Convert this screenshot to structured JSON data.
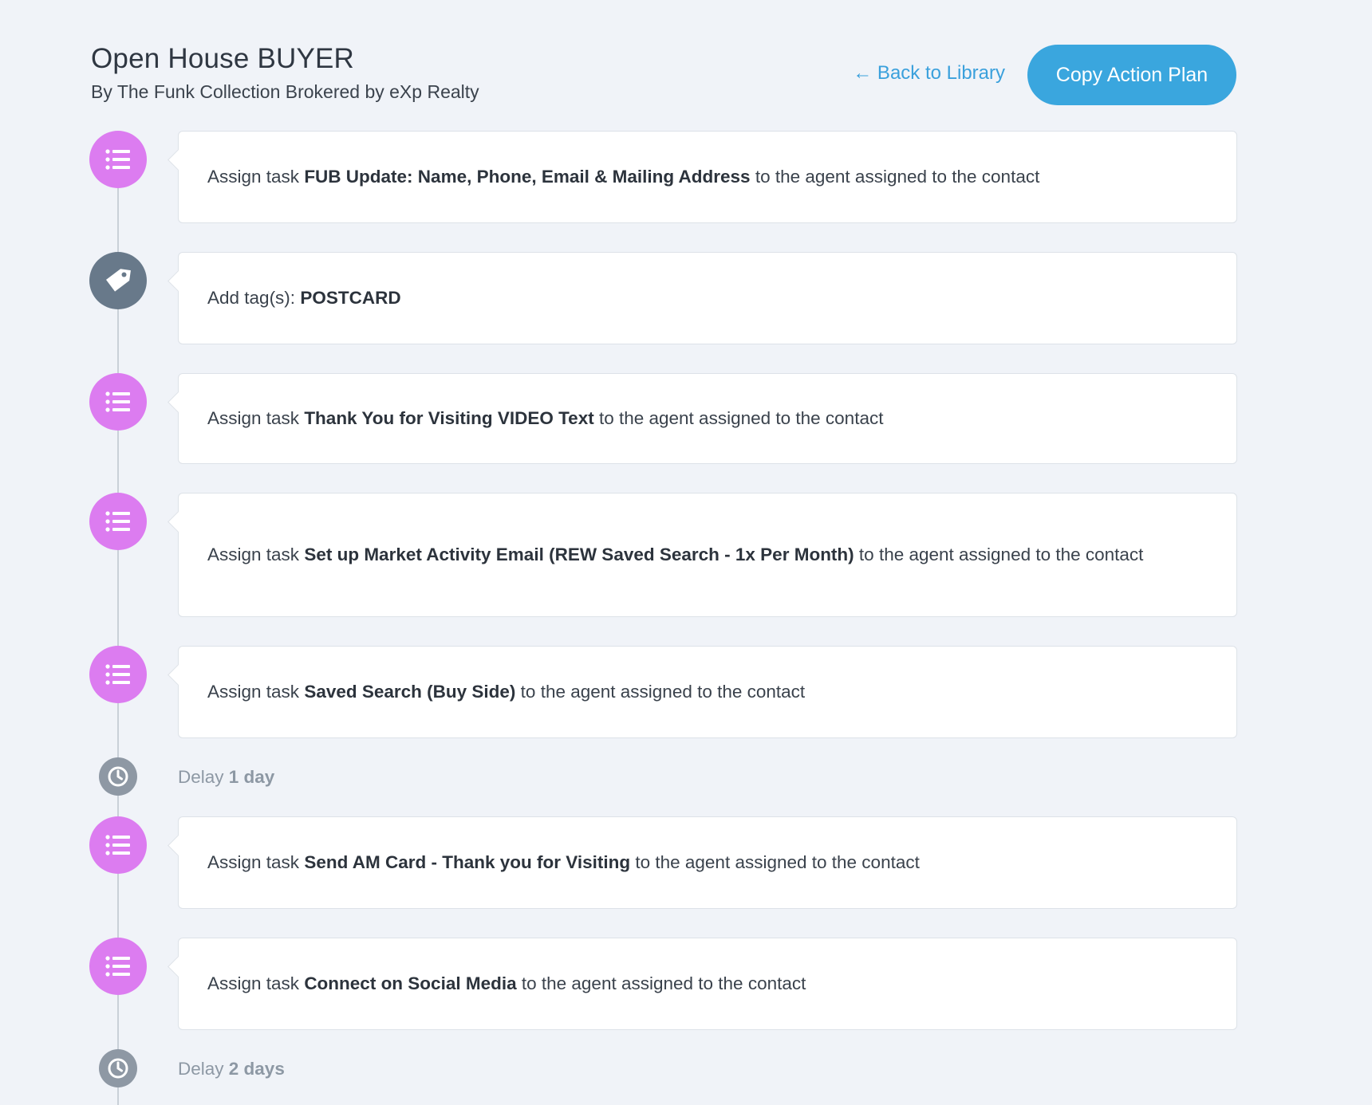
{
  "header": {
    "title": "Open House BUYER",
    "byline": "By The Funk Collection Brokered by eXp Realty",
    "back_link": "← Back to Library",
    "copy_button": "Copy Action Plan"
  },
  "colors": {
    "task_icon": "#dc7cf0",
    "tag_icon": "#68798a",
    "delay_icon": "#8e98a4",
    "accent": "#3aa6de",
    "background": "#f0f3f8"
  },
  "steps": [
    {
      "type": "task",
      "icon": "list-icon",
      "prefix": "Assign task ",
      "bold": "FUB Update: Name, Phone, Email & Mailing Address",
      "suffix": " to the agent assigned to the contact"
    },
    {
      "type": "tag",
      "icon": "tag-icon",
      "prefix": "Add tag(s): ",
      "bold": "POSTCARD",
      "suffix": ""
    },
    {
      "type": "task",
      "icon": "list-icon",
      "prefix": "Assign task ",
      "bold": "Thank You for Visiting VIDEO Text",
      "suffix": " to the agent assigned to the contact"
    },
    {
      "type": "task",
      "icon": "list-icon",
      "prefix": "Assign task ",
      "bold": "Set up Market Activity Email (REW Saved Search - 1x Per Month)",
      "suffix": " to the agent assigned to the contact"
    },
    {
      "type": "task",
      "icon": "list-icon",
      "prefix": "Assign task ",
      "bold": "Saved Search (Buy Side)",
      "suffix": " to the agent assigned to the contact"
    },
    {
      "type": "delay",
      "icon": "clock-icon",
      "prefix": "Delay ",
      "bold": "1 day"
    },
    {
      "type": "task",
      "icon": "list-icon",
      "prefix": "Assign task ",
      "bold": "Send AM Card - Thank you for Visiting",
      "suffix": " to the agent assigned to the contact"
    },
    {
      "type": "task",
      "icon": "list-icon",
      "prefix": "Assign task ",
      "bold": "Connect on Social Media",
      "suffix": " to the agent assigned to the contact"
    },
    {
      "type": "delay",
      "icon": "clock-icon",
      "prefix": "Delay ",
      "bold": "2 days"
    }
  ]
}
